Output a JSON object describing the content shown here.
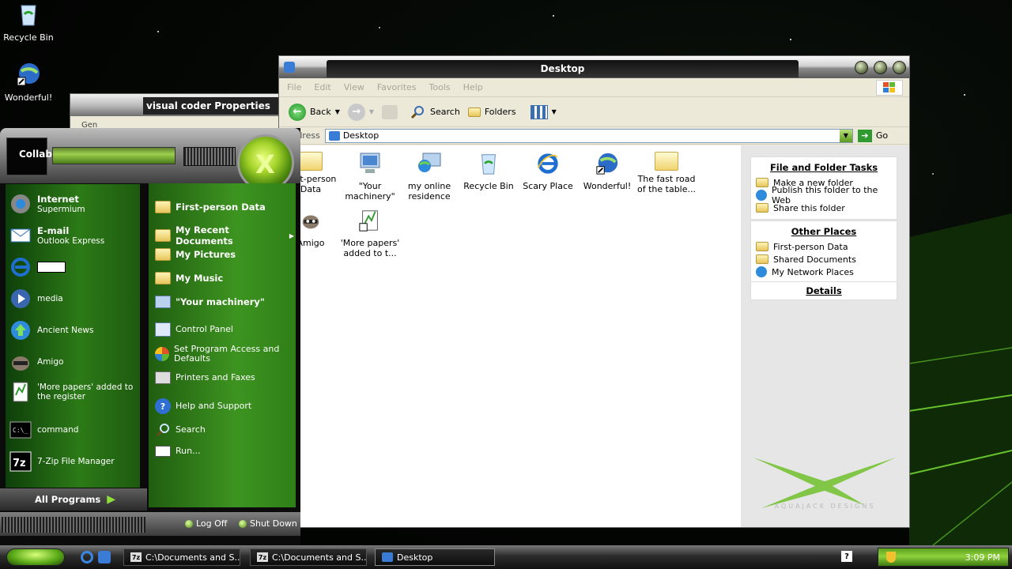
{
  "desktop_icons": [
    {
      "label": "Recycle Bin",
      "icon": "recycle-bin-icon"
    },
    {
      "label": "Wonderful!",
      "icon": "globe-shortcut-icon"
    }
  ],
  "properties_window": {
    "title": "visual coder Properties",
    "tab": "Gen"
  },
  "explorer": {
    "title": "Desktop",
    "menu": [
      "File",
      "Edit",
      "View",
      "Favorites",
      "Tools",
      "Help"
    ],
    "toolbar": {
      "back": "Back",
      "search": "Search",
      "folders": "Folders"
    },
    "address": {
      "label": "Address",
      "value": "Desktop",
      "go": "Go"
    },
    "files": [
      {
        "label": "First-person Data",
        "icon": "documents-folder-icon"
      },
      {
        "label": "\"Your machinery\"",
        "icon": "my-computer-icon"
      },
      {
        "label": "my online residence",
        "icon": "network-places-icon"
      },
      {
        "label": "Recycle Bin",
        "icon": "recycle-bin-icon"
      },
      {
        "label": "Scary Place",
        "icon": "internet-explorer-icon"
      },
      {
        "label": "Wonderful!",
        "icon": "globe-shortcut-icon"
      },
      {
        "label": "The fast road of the table...",
        "icon": "folder-icon"
      },
      {
        "label": "Amigo",
        "icon": "raccoon-icon"
      },
      {
        "label": "'More papers' added to t...",
        "icon": "notepad-plus-icon"
      }
    ],
    "tasks": {
      "file_folder": {
        "heading": "File and Folder Tasks",
        "items": [
          "Make a new folder",
          "Publish this folder to the Web",
          "Share this folder"
        ]
      },
      "other_places": {
        "heading": "Other Places",
        "items": [
          "First-person Data",
          "Shared Documents",
          "My Network Places"
        ]
      },
      "details": {
        "heading": "Details"
      }
    },
    "watermark": "AQUAJACK DESIGNS"
  },
  "start_menu": {
    "username": "CollabVM",
    "left_items": [
      {
        "title": "Internet",
        "subtitle": "Supermium",
        "icon": "browser-icon"
      },
      {
        "title": "E-mail",
        "subtitle": "Outlook Express",
        "icon": "email-icon"
      },
      {
        "title": "",
        "subtitle": "",
        "icon": "internet-explorer-icon"
      },
      {
        "title": "media",
        "subtitle": "",
        "icon": "media-player-icon"
      },
      {
        "title": "Ancient News",
        "subtitle": "",
        "icon": "update-arrow-icon"
      },
      {
        "title": "Amigo",
        "subtitle": "",
        "icon": "raccoon-icon"
      },
      {
        "title": "'More papers' added to the register",
        "subtitle": "",
        "icon": "notepad-plus-icon"
      },
      {
        "title": "command",
        "subtitle": "",
        "icon": "command-prompt-icon"
      },
      {
        "title": "7-Zip File Manager",
        "subtitle": "",
        "icon": "seven-zip-icon"
      }
    ],
    "all_programs": "All Programs",
    "right_items": [
      {
        "label": "First-person Data",
        "bold": true,
        "icon": "documents-folder-icon"
      },
      {
        "label": "My Recent Documents",
        "bold": true,
        "icon": "recent-documents-icon"
      },
      {
        "label": "My Pictures",
        "bold": true,
        "icon": "pictures-folder-icon"
      },
      {
        "label": "My Music",
        "bold": true,
        "icon": "music-folder-icon"
      },
      {
        "label": "\"Your machinery\"",
        "bold": true,
        "icon": "my-computer-icon"
      },
      {
        "label": "Control Panel",
        "bold": false,
        "icon": "control-panel-icon"
      },
      {
        "label": "Set Program Access and Defaults",
        "bold": false,
        "icon": "program-access-icon"
      },
      {
        "label": "Printers and Faxes",
        "bold": false,
        "icon": "printer-icon"
      },
      {
        "label": "Help and Support",
        "bold": false,
        "icon": "help-icon"
      },
      {
        "label": "Search",
        "bold": false,
        "icon": "search-icon"
      },
      {
        "label": "Run...",
        "bold": false,
        "icon": "run-icon"
      }
    ],
    "log_off": "Log Off",
    "shut_down": "Shut Down"
  },
  "taskbar": {
    "tasks": [
      {
        "label": "C:\\Documents and S...",
        "icon": "seven-zip-icon"
      },
      {
        "label": "C:\\Documents and S...",
        "icon": "seven-zip-icon"
      },
      {
        "label": "Desktop",
        "icon": "folder-window-icon"
      }
    ],
    "clock": "3:09 PM"
  }
}
